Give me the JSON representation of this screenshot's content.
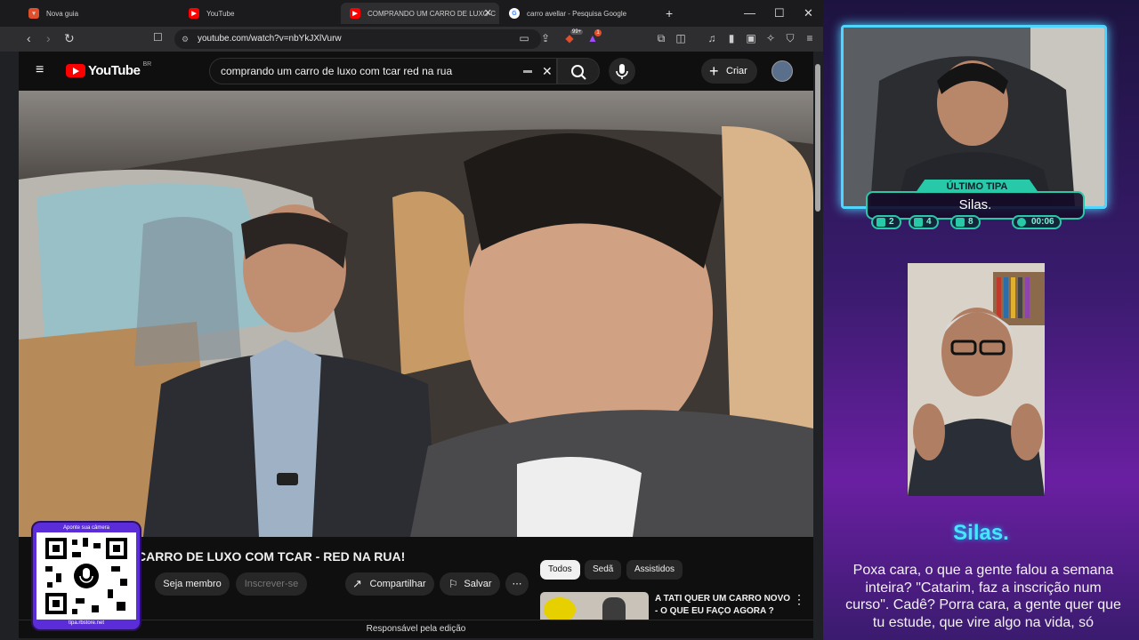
{
  "browser": {
    "tabs": [
      {
        "label": "Nova guia",
        "icon": "brave-icon"
      },
      {
        "label": "YouTube",
        "icon": "youtube-icon"
      },
      {
        "label": "COMPRANDO UM CARRO DE LUXO C",
        "icon": "youtube-icon",
        "active": true
      },
      {
        "label": "carro avellar - Pesquisa Google",
        "icon": "google-icon"
      }
    ],
    "new_tab": "+",
    "url": "youtube.com/watch?v=nbYkJXlVurw",
    "shield_badge": "99+",
    "rewards_badge": "1"
  },
  "youtube": {
    "logo_text": "YouTube",
    "region": "BR",
    "search_value": "comprando um carro de luxo com tcar red na rua",
    "create_label": "Criar",
    "video_title": "CARRO DE LUXO COM TCAR - RED NA RUA!",
    "buttons": {
      "join": "Seja membro",
      "subscribe": "Inscrever-se",
      "share": "Compartilhar",
      "save": "Salvar"
    },
    "chips": [
      "Todos",
      "Sedã",
      "Assistidos"
    ],
    "recommendation": {
      "title_line1": "A TATI QUER UM CARRO NOVO",
      "title_line2": "- O QUE EU FAÇO AGORA ?"
    },
    "status_bar": "Responsável pela edição"
  },
  "qr_overlay": {
    "top_text": "Aponte sua câmera",
    "bottom_text": "tipa.rbstore.net"
  },
  "stream": {
    "tipa_label": "ÚLTIMO TIPA",
    "tipa_name": "Silas.",
    "stats": [
      {
        "icon": "twitch-icon",
        "value": "2"
      },
      {
        "icon": "youtube-icon",
        "value": "4"
      },
      {
        "icon": "kick-icon",
        "value": "8"
      },
      {
        "icon": "whatsapp-icon",
        "value": "00:06"
      }
    ],
    "speaker_name": "Silas.",
    "message": "Poxa cara, o que a gente falou a semana inteira? \"Catarim, faz a inscrição num curso\". Cadê? Porra cara, a gente quer que tu estude, que vire algo na vida, só"
  },
  "colors": {
    "accent": "#4fd6ff",
    "teal": "#27c9a8",
    "youtube_red": "#ff0000",
    "qr_border": "#5a2dd8"
  }
}
